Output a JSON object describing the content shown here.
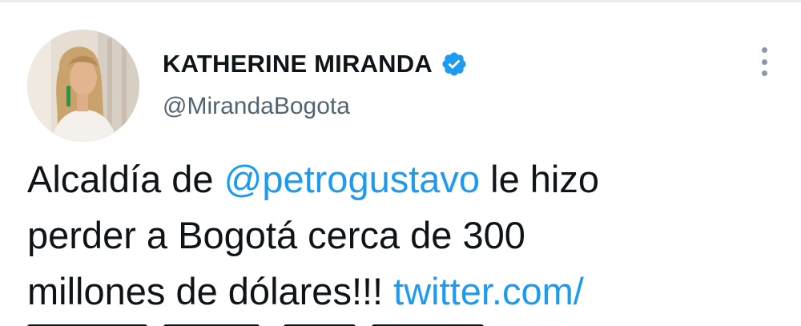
{
  "tweet": {
    "display_name": "KATHERINE MIRANDA",
    "handle": "@MirandaBogota",
    "verified_icon": "verified-badge-icon",
    "more_icon": "more-options-icon",
    "avatar_icon": "profile-photo",
    "text": {
      "line1_prefix": "Alcaldía de ",
      "line1_mention": "@petrogustavo",
      "line1_suffix": " le hizo",
      "line2": "perder a Bogotá cerca de 300",
      "line3_prefix": "millones de dólares!!! ",
      "line3_link": "twitter.com/"
    }
  },
  "colors": {
    "text": "#0f1419",
    "secondary_text": "#536471",
    "link": "#1d9bf0",
    "verified_badge": "#1d9bf0",
    "divider": "#e8ecef"
  }
}
